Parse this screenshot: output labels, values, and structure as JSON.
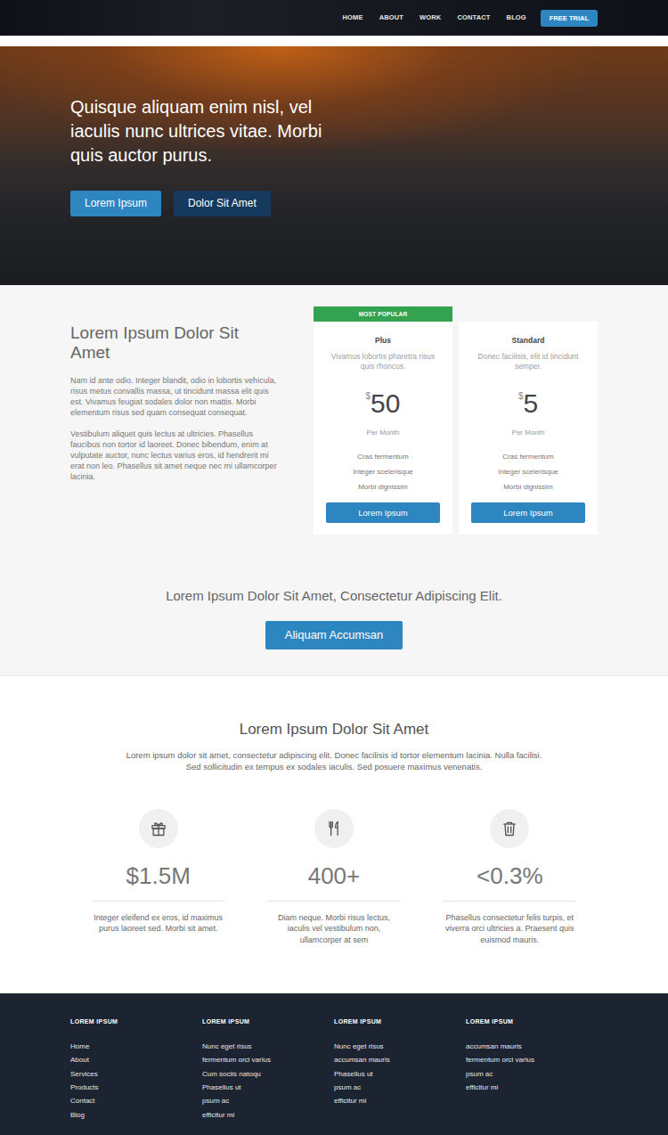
{
  "nav": {
    "links": [
      {
        "label": "HOME"
      },
      {
        "label": "ABOUT"
      },
      {
        "label": "WORK"
      },
      {
        "label": "CONTACT"
      },
      {
        "label": "BLOG"
      }
    ],
    "cta": "FREE TRIAL"
  },
  "hero": {
    "heading": "Quisque aliquam enim nisl, vel iaculis nunc ultrices vitae. Morbi quis auctor purus.",
    "buttons": [
      "Lorem Ipsum",
      "Dolor Sit Amet"
    ]
  },
  "intro": {
    "heading": "Lorem Ipsum Dolor Sit Amet",
    "paragraphs": [
      "Nam id ante odio. Integer blandit, odio in lobortis vehicula, risus metus convallis massa, ut tincidunt massa elit quis est. Vivamus feugiat sodales dolor non mattis. Morbi elementum risus sed quam consequat consequat.",
      "Vestibulum aliquet quis lectus at ultricies. Phasellus faucibus non tortor id laoreet. Donec bibendum, enim at vulputate auctor, nunc lectus varius eros, id hendrerit mi erat non leo. Phasellus sit amet neque nec mi ullamcorper lacinia."
    ]
  },
  "plans": [
    {
      "featured": true,
      "badge": "MOST POPULAR",
      "name": "Plus",
      "description": "Vivamus lobortis pharetra risus quis rhoncus.",
      "currency": "$",
      "amount": "50",
      "period": "Per Month",
      "features": [
        "Cras fermentum",
        "Integer scelerisque",
        "Morbi dignissim"
      ],
      "button": "Lorem Ipsum"
    },
    {
      "featured": false,
      "name": "Standard",
      "description": "Donec facilisis, elit id tincidunt semper.",
      "currency": "$",
      "amount": "5",
      "period": "Per Month",
      "features": [
        "Cras fermentum",
        "Integer scelerisque",
        "Morbi dignissim"
      ],
      "button": "Lorem Ipsum"
    }
  ],
  "cta": {
    "text": "Lorem Ipsum Dolor Sit Amet, Consectetur Adipiscing Elit.",
    "button": "Aliquam Accumsan"
  },
  "stats": {
    "heading": "Lorem Ipsum Dolor Sit Amet",
    "intro": "Lorem ipsum dolor sit amet, consectetur adipiscing elit. Donec facilisis id tortor elementum lacinia. Nulla facilisi. Sed sollicitudin ex tempus ex sodales iaculis. Sed posuere maximus venenatis.",
    "items": [
      {
        "value": "$1.5M",
        "text": "Integer eleifend ex eros, id maximus purus laoreet sed. Morbi sit amet."
      },
      {
        "value": "400+",
        "text": "Diam neque. Morbi risus lectus, iaculis vel vestibulum non, ullamcorper at sem"
      },
      {
        "value": "<0.3%",
        "text": "Phasellus consectetur felis turpis, et viverra orci ultricies a. Praesent quis euismod mauris."
      }
    ]
  },
  "footer": {
    "columns": [
      {
        "heading": "LOREM IPSUM",
        "links": [
          "Home",
          "About",
          "Services",
          "Products",
          "Contact",
          "Blog"
        ]
      },
      {
        "heading": "LOREM IPSUM",
        "links": [
          "Nunc eget risus",
          "fermentum orci varius",
          "Cum sociis natoqu",
          "Phasellus ut",
          "psum ac",
          "efficitur mi"
        ]
      },
      {
        "heading": "LOREM IPSUM",
        "links": [
          "Nunc eget risus",
          "accumsan mauris",
          "Phasellus ut",
          "psum ac",
          "efficitur mi"
        ]
      },
      {
        "heading": "LOREM IPSUM",
        "links": [
          "accumsan mauris",
          "fermentum orci varius",
          "psum ac",
          "efficitur mi"
        ]
      }
    ]
  }
}
